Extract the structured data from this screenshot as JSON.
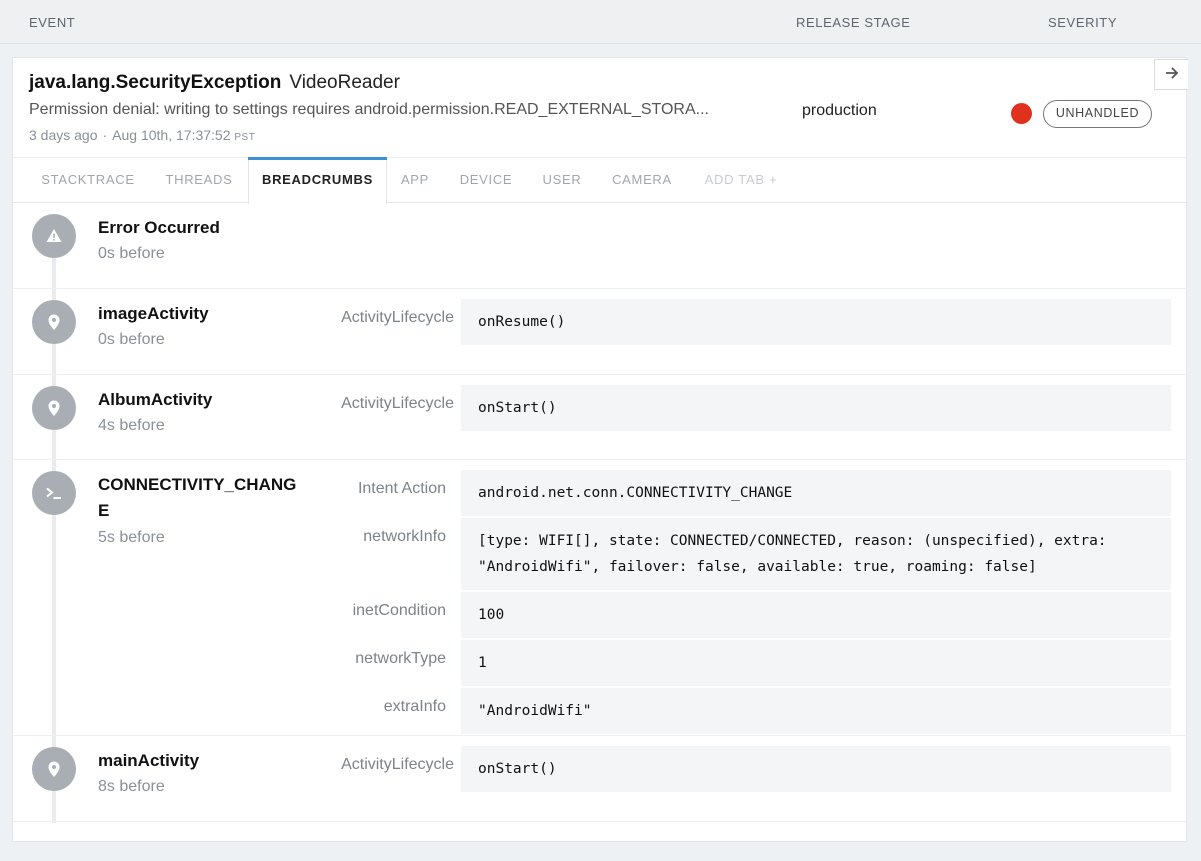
{
  "columns": {
    "event": "EVENT",
    "release_stage": "RELEASE STAGE",
    "severity": "SEVERITY"
  },
  "event": {
    "error_class": "java.lang.SecurityException",
    "context": "VideoReader",
    "message": "Permission denial: writing to settings requires android.permission.READ_EXTERNAL_STORA...",
    "relative_time": "3 days ago",
    "separator": "·",
    "timestamp": "Aug 10th, 17:37:52",
    "timezone": "PST",
    "release_stage": "production",
    "severity_color": "#e0301e",
    "handled_badge": "UNHANDLED",
    "open_icon": "arrow-right-icon"
  },
  "tabs": [
    {
      "label": "STACKTRACE",
      "state": "normal"
    },
    {
      "label": "THREADS",
      "state": "normal"
    },
    {
      "label": "BREADCRUMBS",
      "state": "active"
    },
    {
      "label": "APP",
      "state": "normal"
    },
    {
      "label": "DEVICE",
      "state": "normal"
    },
    {
      "label": "USER",
      "state": "normal"
    },
    {
      "label": "CAMERA",
      "state": "normal"
    },
    {
      "label": "ADD TAB +",
      "state": "disabled"
    }
  ],
  "accent_color": "#3d8fd6",
  "breadcrumbs": [
    {
      "icon": "warning-icon",
      "title": "Error Occurred",
      "time": "0s before",
      "metadata": []
    },
    {
      "icon": "location-pin-icon",
      "title": "imageActivity",
      "time": "0s before",
      "metadata": [
        {
          "key": "ActivityLifecycle",
          "value": "onResume()"
        }
      ]
    },
    {
      "icon": "location-pin-icon",
      "title": "AlbumActivity",
      "time": "4s before",
      "metadata": [
        {
          "key": "ActivityLifecycle",
          "value": "onStart()"
        }
      ]
    },
    {
      "icon": "terminal-icon",
      "title": "CONNECTIVITY_CHANGE",
      "time": "5s before",
      "metadata": [
        {
          "key": "Intent Action",
          "value": "android.net.conn.CONNECTIVITY_CHANGE"
        },
        {
          "key": "networkInfo",
          "value": "[type: WIFI[], state: CONNECTED/CONNECTED, reason: (unspecified), extra: \"AndroidWifi\", failover: false, available: true, roaming: false]"
        },
        {
          "key": "inetCondition",
          "value": "100"
        },
        {
          "key": "networkType",
          "value": "1"
        },
        {
          "key": "extraInfo",
          "value": "\"AndroidWifi\""
        }
      ]
    },
    {
      "icon": "location-pin-icon",
      "title": "mainActivity",
      "time": "8s before",
      "metadata": [
        {
          "key": "ActivityLifecycle",
          "value": "onStart()"
        }
      ]
    }
  ]
}
